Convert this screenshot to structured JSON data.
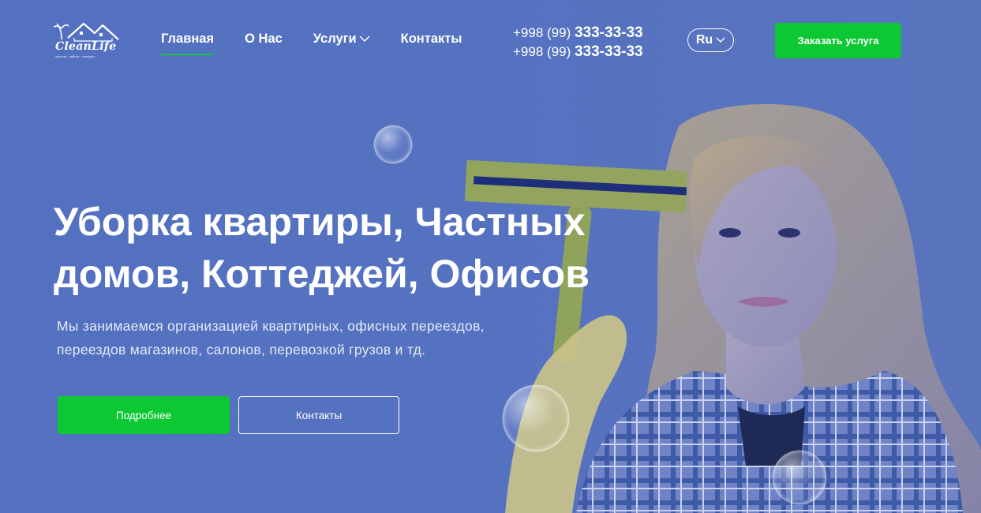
{
  "brand": {
    "name": "CleanLife",
    "tagline": "чистота · забота · комфорт"
  },
  "nav": {
    "items": [
      {
        "label": "Главная",
        "active": true
      },
      {
        "label": "О Нас",
        "active": false
      },
      {
        "label": "Услуги",
        "active": false,
        "has_dropdown": true
      },
      {
        "label": "Контакты",
        "active": false
      }
    ]
  },
  "contacts": {
    "phones": [
      {
        "prefix": "+998 (99)",
        "number": "333-33-33"
      },
      {
        "prefix": "+998 (99)",
        "number": "333-33-33"
      }
    ]
  },
  "language": {
    "selected": "Ru"
  },
  "header_cta": {
    "label": "Заказать услуга"
  },
  "hero": {
    "title_line1": "Уборка квартиры, Частных",
    "title_line2": "домов, Коттеджей, Офисов",
    "subtitle_line1": "Мы занимаемся организацией квартирных, офисных переездов,",
    "subtitle_line2": "переездов магазинов, салонов, перевозкой грузов и тд.",
    "primary_button": "Подробнее",
    "secondary_button": "Контакты"
  },
  "icons": {
    "logo": "house-roof-palm-icon",
    "dropdown": "chevron-down-icon"
  },
  "colors": {
    "background": "#5572c0",
    "accent": "#0cc832",
    "text": "#ffffff"
  }
}
